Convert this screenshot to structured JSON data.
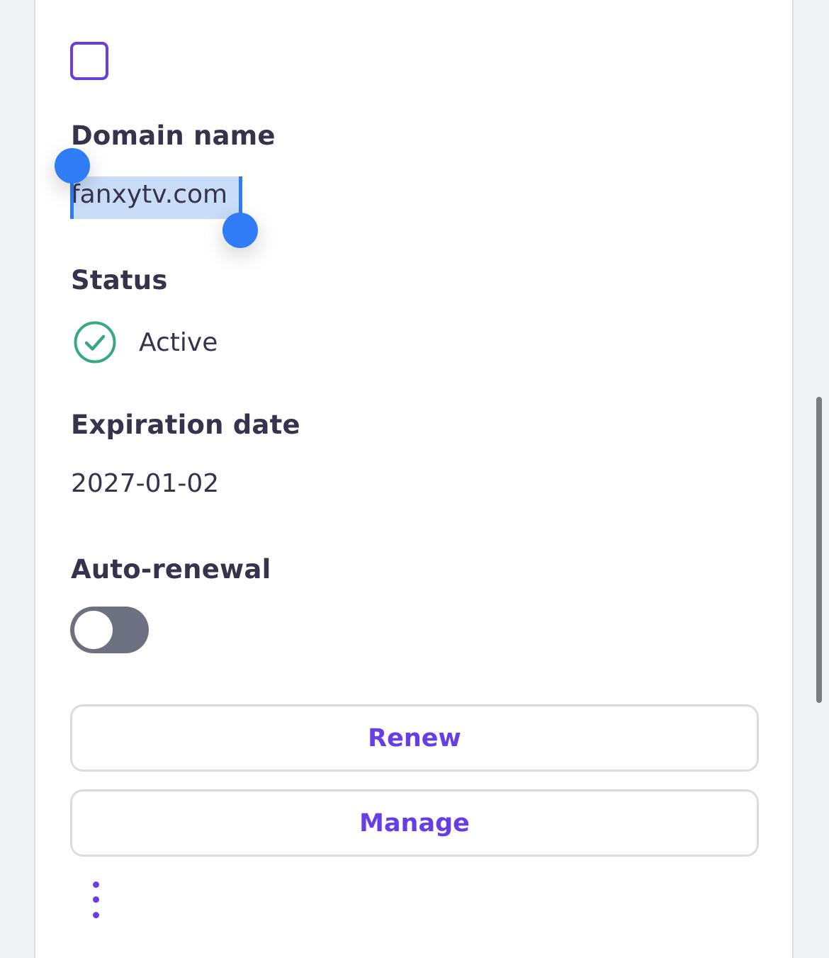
{
  "domain": {
    "label": "Domain name",
    "value": "fanxytv.com"
  },
  "status": {
    "label": "Status",
    "value": "Active",
    "icon": "check-circle-icon",
    "color": "#3aa783"
  },
  "expiration": {
    "label": "Expiration date",
    "value": "2027-01-02"
  },
  "auto_renewal": {
    "label": "Auto-renewal",
    "enabled": false
  },
  "actions": {
    "renew_label": "Renew",
    "manage_label": "Manage",
    "more_icon": "more-vertical-icon"
  },
  "colors": {
    "accent": "#673de6",
    "text": "#36344d",
    "selection_handle": "#2f7cf6",
    "toggle_off": "#6d7081"
  }
}
